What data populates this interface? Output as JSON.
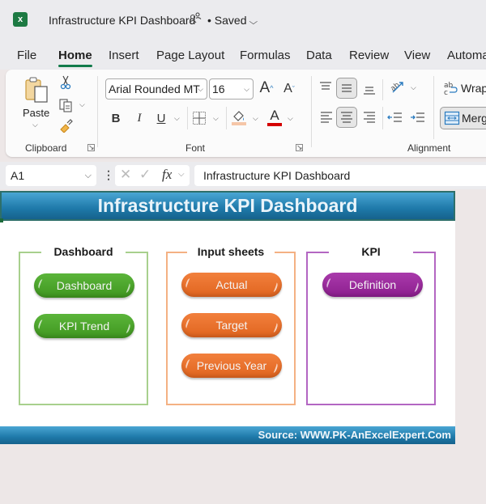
{
  "titlebar": {
    "app_icon": "excel-icon",
    "doc_title": "Infrastructure KPI Dashboard",
    "share_icon": "people-icon",
    "save_status": "• Saved"
  },
  "menu": {
    "items": [
      "File",
      "Home",
      "Insert",
      "Page Layout",
      "Formulas",
      "Data",
      "Review",
      "View",
      "Automa"
    ],
    "active": "Home"
  },
  "ribbon": {
    "clipboard": {
      "paste_label": "Paste",
      "group_label": "Clipboard"
    },
    "font": {
      "font_name": "Arial Rounded MT",
      "font_size": "16",
      "bold": "B",
      "italic": "I",
      "underline": "U",
      "grow": "A",
      "shrink": "A",
      "font_color_glyph": "A",
      "font_color": "#d40000",
      "fill_color": "#f5c6a8",
      "group_label": "Font"
    },
    "alignment": {
      "wrap_label": "Wrap",
      "merge_label": "Merg",
      "group_label": "Alignment"
    }
  },
  "formula_bar": {
    "name_box": "A1",
    "fx": "fx",
    "formula": "Infrastructure KPI Dashboard"
  },
  "sheet": {
    "banner_title": "Infrastructure KPI Dashboard",
    "footer": "Source: WWW.PK-AnExcelExpert.Com",
    "panels": [
      {
        "title": "Dashboard",
        "color": "#a8d08d",
        "button_color": "#4ea72e",
        "buttons": [
          "Dashboard",
          "KPI Trend"
        ]
      },
      {
        "title": "Input sheets",
        "color": "#f4b183",
        "button_color": "#ec7431",
        "buttons": [
          "Actual",
          "Target",
          "Previous Year"
        ]
      },
      {
        "title": "KPI",
        "color": "#b366c2",
        "button_color": "#9d2a9f",
        "buttons": [
          "Definition"
        ]
      }
    ]
  }
}
